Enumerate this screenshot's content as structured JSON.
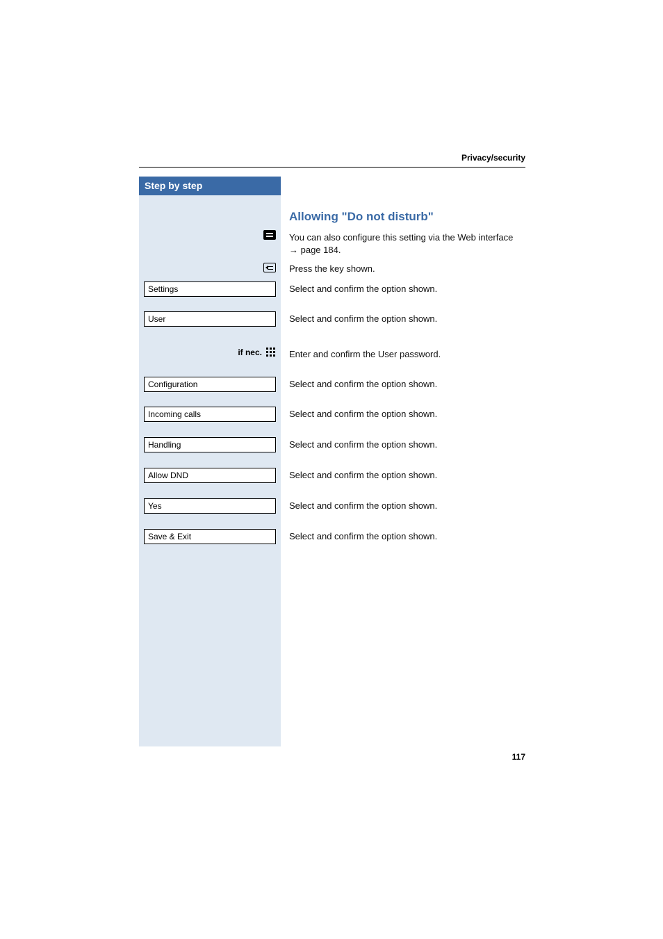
{
  "header": {
    "section_label": "Privacy/security"
  },
  "sidebar": {
    "title": "Step by step",
    "label_ifnec": "if nec.",
    "items": [
      {
        "label": "Settings"
      },
      {
        "label": "User"
      },
      {
        "label": "Configuration"
      },
      {
        "label": "Incoming calls"
      },
      {
        "label": "Handling"
      },
      {
        "label": "Allow DND"
      },
      {
        "label": "Yes"
      },
      {
        "label": "Save & Exit"
      }
    ]
  },
  "content": {
    "title": "Allowing \"Do not disturb\"",
    "web_line1": "You can also configure this setting via the Web interface",
    "web_line2_arrow": "→",
    "web_line2_rest": " page 184.",
    "press_key": "Press the key shown.",
    "select_confirm": "Select and confirm the option shown.",
    "enter_password": "Enter and confirm the User password."
  },
  "page_number": "117",
  "icons": {
    "list_menu": "list-menu-icon",
    "services_menu": "menu-arrow-icon",
    "keypad": "keypad-icon"
  }
}
